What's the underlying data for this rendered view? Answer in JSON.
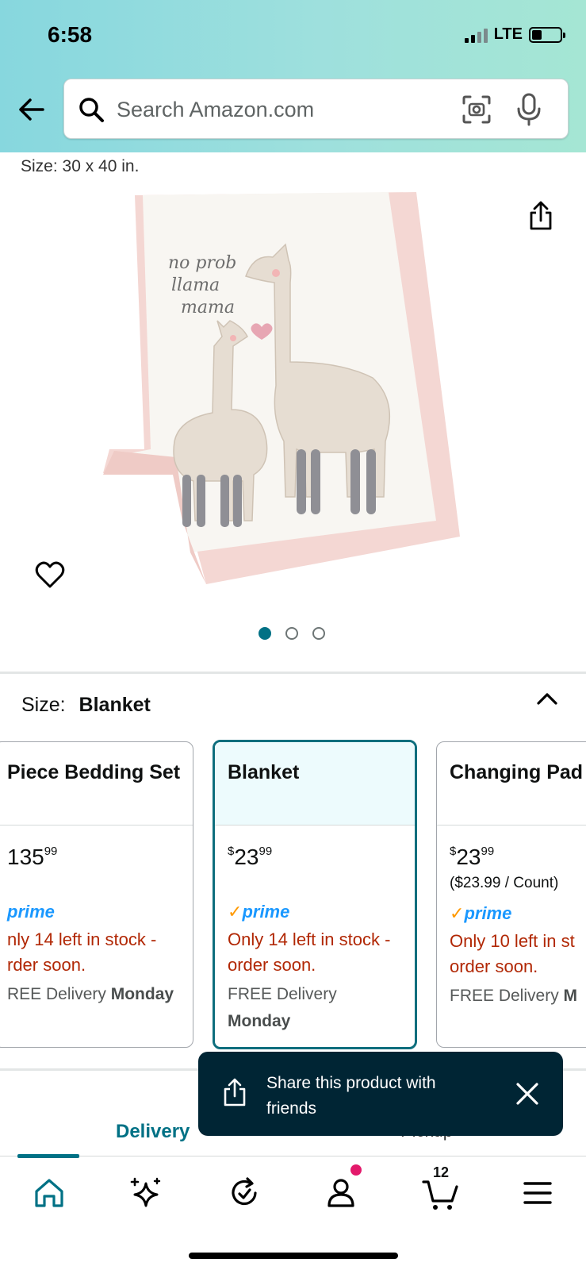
{
  "status_bar": {
    "time": "6:58",
    "network": "LTE"
  },
  "search": {
    "placeholder": "Search Amazon.com"
  },
  "product": {
    "size_line": "Size: 30 x 40 in.",
    "image_text": "no prob llama mama",
    "carousel": {
      "count": 3,
      "active_index": 0
    }
  },
  "size_selector": {
    "label": "Size:",
    "selected_value": "Blanket",
    "options": [
      {
        "title": "Piece Bedding Set",
        "price_dollars": "135",
        "price_cents": "99",
        "per_count": "",
        "prime": "prime",
        "stock": "nly 14 left in stock - rder soon.",
        "delivery_prefix": "REE Delivery",
        "delivery_day": "Monday"
      },
      {
        "title": "Blanket",
        "price_symbol": "$",
        "price_dollars": "23",
        "price_cents": "99",
        "per_count": "",
        "prime": "prime",
        "stock": "Only 14 left in stock - order soon.",
        "delivery_prefix": "FREE Delivery",
        "delivery_day": "Monday"
      },
      {
        "title": "Changing Pad",
        "price_symbol": "$",
        "price_dollars": "23",
        "price_cents": "99",
        "per_count": "($23.99 / Count)",
        "prime": "prime",
        "stock": "Only 10 left in st order soon.",
        "delivery_prefix": "FREE Delivery",
        "delivery_day": "M"
      }
    ]
  },
  "tabs": {
    "delivery": "Delivery",
    "pickup": "Pickup"
  },
  "toast": {
    "text": "Share this product with friends"
  },
  "bottom_nav": {
    "items": [
      "home-icon",
      "sparkle-icon",
      "refresh-icon",
      "account-icon",
      "cart-icon",
      "menu-icon"
    ],
    "cart_count": "12"
  },
  "colors": {
    "accent": "#007185",
    "prime_blue": "#1a98ff",
    "stock_red": "#b12704",
    "toast_bg": "#002534"
  }
}
